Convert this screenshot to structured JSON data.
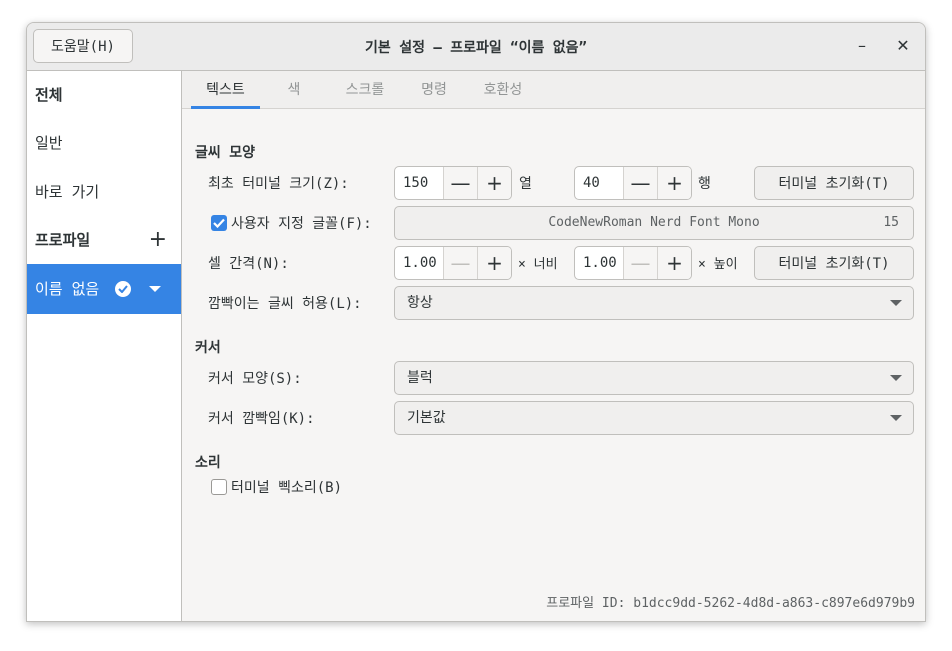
{
  "titlebar": {
    "help_label": "도움말(H)",
    "title": "기본 설정 – 프로파일 “이름 없음”",
    "minimize_glyph": "–",
    "close_glyph": "✕"
  },
  "sidebar": {
    "all_label": "전체",
    "general_label": "일반",
    "shortcuts_label": "바로 가기",
    "profiles_label": "프로파일",
    "add_glyph": "+",
    "profile_name": "이름 없음"
  },
  "tabs": [
    {
      "label": "텍스트"
    },
    {
      "label": "색"
    },
    {
      "label": "스크롤"
    },
    {
      "label": "명령"
    },
    {
      "label": "호환성"
    }
  ],
  "text_tab": {
    "appearance_section": "글씨 모양",
    "initial_size_label": "최초 터미널 크기(Z):",
    "columns_value": "150",
    "columns_unit": "열",
    "rows_value": "40",
    "rows_unit": "행",
    "reset_label": "터미널 초기화(T)",
    "custom_font_label": "사용자 지정 글꼴(F):",
    "custom_font_checked": true,
    "font_name": "CodeNewRoman Nerd Font Mono",
    "font_size": "15",
    "cell_spacing_label": "셀 간격(N):",
    "width_value": "1.00",
    "width_unit": "× 너비",
    "height_value": "1.00",
    "height_unit": "× 높이",
    "blink_label": "깜빡이는 글씨 허용(L):",
    "blink_value": "항상",
    "cursor_section": "커서",
    "cursor_shape_label": "커서 모양(S):",
    "cursor_shape_value": "블럭",
    "cursor_blink_label": "커서 깜빡임(K):",
    "cursor_blink_value": "기본값",
    "sound_section": "소리",
    "bell_label": "터미널 삑소리(B)",
    "bell_checked": false,
    "minus_glyph": "—",
    "plus_glyph": "+",
    "profile_id": "프로파일 ID: b1dcc9dd-5262-4d8d-a863-c897e6d979b9"
  },
  "colors": {
    "accent": "#3584e4",
    "window_bg": "#f6f5f4",
    "border": "#c0bfbc"
  }
}
